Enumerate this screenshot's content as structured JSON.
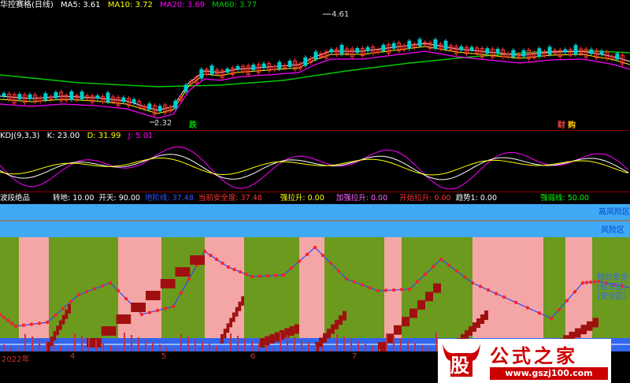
{
  "price_panel": {
    "title": "华控赛格(日线)",
    "ma5_label": "MA5: 3.61",
    "ma10_label": "MA10: 3.72",
    "ma20_label": "MA20: 3.69",
    "ma60_label": "MA60: 3.77",
    "high_marker": "4.61",
    "low_marker": "2.32",
    "event_die": "跌",
    "event_cai": "财",
    "event_gou": "购",
    "colors": {
      "ma5": "#ffffff",
      "ma10": "#ffff00",
      "ma20": "#ff00ff",
      "ma60": "#00cc00",
      "up": "#ff3333",
      "down": "#00cccc"
    }
  },
  "kdj_panel": {
    "title": "KDJ(9,3,3)",
    "k_label": "K: 23.00",
    "d_label": "D: 31.99",
    "j_label": "J: 5.01",
    "colors": {
      "k": "#ffffff",
      "d": "#ffff00",
      "j": "#ff00ff"
    }
  },
  "wave_panel": {
    "title": "波段绝品",
    "v1": "转地: 10.00",
    "v2": "开天: 90.00",
    "v3": "地阶线: 37.48",
    "v4": "当前安全度: 37.48",
    "v5": "强拉升: 0.00",
    "v6": "加强拉升: 0.00",
    "v7": "开始拉升: 0.00",
    "v8": "趋势1: 0.00",
    "v9": "强弱线: 50.00",
    "zone_high": "高风险区",
    "zone_risk": "风险区",
    "zone_safe_1": "相对安全",
    "zone_safe_2": "(投资区)",
    "zone_safe_3": "(安全区)"
  },
  "x_axis": {
    "year": "2022年",
    "m4": "4",
    "m5": "5",
    "m6": "6",
    "m7": "7"
  },
  "watermark": {
    "glyph": "股",
    "brand": "公式之家",
    "url": "www.gszj100.com"
  }
}
